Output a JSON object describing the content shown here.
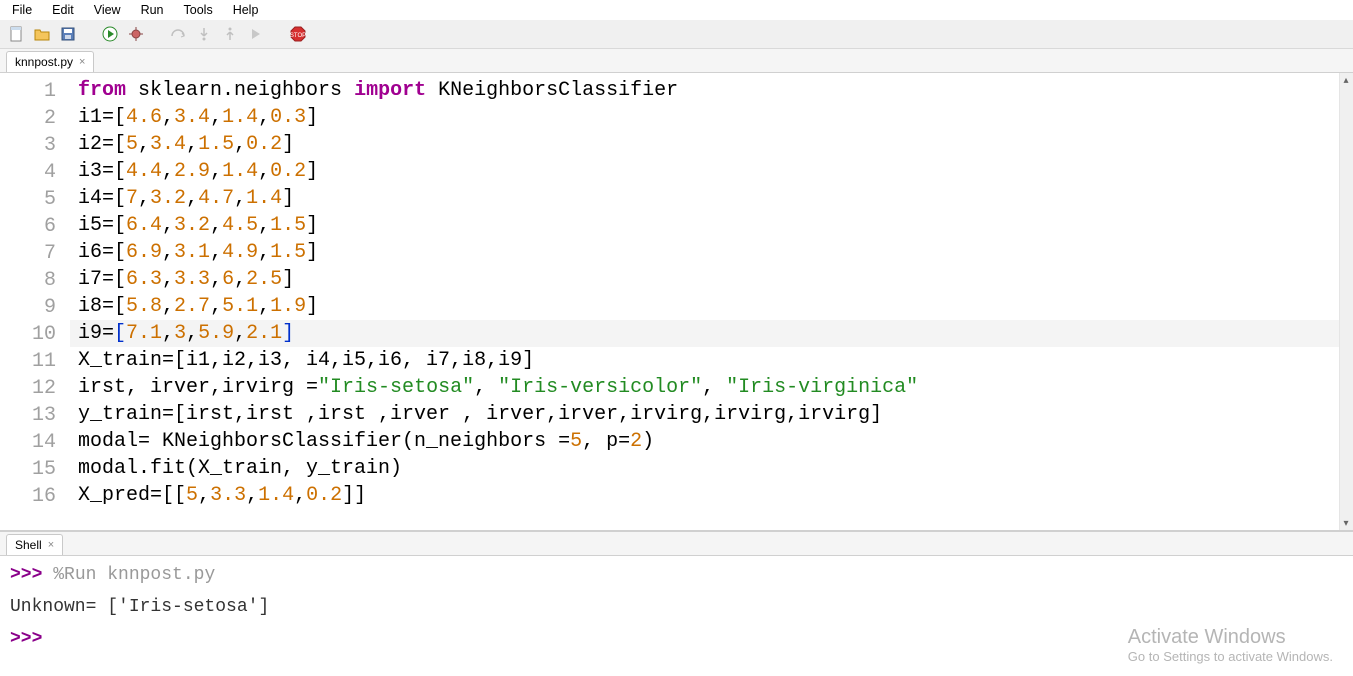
{
  "menubar": [
    "File",
    "Edit",
    "View",
    "Run",
    "Tools",
    "Help"
  ],
  "toolbar": {
    "new": "new-file-icon",
    "open": "open-folder-icon",
    "save": "save-icon",
    "run": "run-icon",
    "debug": "debug-icon",
    "step_over": "step-over-icon",
    "step_into": "step-into-icon",
    "step_out": "step-out-icon",
    "resume": "resume-icon",
    "stop": "stop-icon"
  },
  "editor_tab": {
    "label": "knnpost.py",
    "close": "×"
  },
  "code_lines": [
    {
      "n": 1,
      "tokens": [
        {
          "t": "from",
          "c": "kw"
        },
        {
          "t": " sklearn.neighbors ",
          "c": "pn"
        },
        {
          "t": "import",
          "c": "kw"
        },
        {
          "t": " KNeighborsClassifier",
          "c": "pn"
        }
      ]
    },
    {
      "n": 2,
      "tokens": [
        {
          "t": "i1=[",
          "c": "pn"
        },
        {
          "t": "4.6",
          "c": "nm"
        },
        {
          "t": ",",
          "c": "pn"
        },
        {
          "t": "3.4",
          "c": "nm"
        },
        {
          "t": ",",
          "c": "pn"
        },
        {
          "t": "1.4",
          "c": "nm"
        },
        {
          "t": ",",
          "c": "pn"
        },
        {
          "t": "0.3",
          "c": "nm"
        },
        {
          "t": "]",
          "c": "pn"
        }
      ]
    },
    {
      "n": 3,
      "tokens": [
        {
          "t": "i2=[",
          "c": "pn"
        },
        {
          "t": "5",
          "c": "nm"
        },
        {
          "t": ",",
          "c": "pn"
        },
        {
          "t": "3.4",
          "c": "nm"
        },
        {
          "t": ",",
          "c": "pn"
        },
        {
          "t": "1.5",
          "c": "nm"
        },
        {
          "t": ",",
          "c": "pn"
        },
        {
          "t": "0.2",
          "c": "nm"
        },
        {
          "t": "]",
          "c": "pn"
        }
      ]
    },
    {
      "n": 4,
      "tokens": [
        {
          "t": "i3=[",
          "c": "pn"
        },
        {
          "t": "4.4",
          "c": "nm"
        },
        {
          "t": ",",
          "c": "pn"
        },
        {
          "t": "2.9",
          "c": "nm"
        },
        {
          "t": ",",
          "c": "pn"
        },
        {
          "t": "1.4",
          "c": "nm"
        },
        {
          "t": ",",
          "c": "pn"
        },
        {
          "t": "0.2",
          "c": "nm"
        },
        {
          "t": "]",
          "c": "pn"
        }
      ]
    },
    {
      "n": 5,
      "tokens": [
        {
          "t": "i4=[",
          "c": "pn"
        },
        {
          "t": "7",
          "c": "nm"
        },
        {
          "t": ",",
          "c": "pn"
        },
        {
          "t": "3.2",
          "c": "nm"
        },
        {
          "t": ",",
          "c": "pn"
        },
        {
          "t": "4.7",
          "c": "nm"
        },
        {
          "t": ",",
          "c": "pn"
        },
        {
          "t": "1.4",
          "c": "nm"
        },
        {
          "t": "]",
          "c": "pn"
        }
      ]
    },
    {
      "n": 6,
      "tokens": [
        {
          "t": "i5=[",
          "c": "pn"
        },
        {
          "t": "6.4",
          "c": "nm"
        },
        {
          "t": ",",
          "c": "pn"
        },
        {
          "t": "3.2",
          "c": "nm"
        },
        {
          "t": ",",
          "c": "pn"
        },
        {
          "t": "4.5",
          "c": "nm"
        },
        {
          "t": ",",
          "c": "pn"
        },
        {
          "t": "1.5",
          "c": "nm"
        },
        {
          "t": "]",
          "c": "pn"
        }
      ]
    },
    {
      "n": 7,
      "tokens": [
        {
          "t": "i6=[",
          "c": "pn"
        },
        {
          "t": "6.9",
          "c": "nm"
        },
        {
          "t": ",",
          "c": "pn"
        },
        {
          "t": "3.1",
          "c": "nm"
        },
        {
          "t": ",",
          "c": "pn"
        },
        {
          "t": "4.9",
          "c": "nm"
        },
        {
          "t": ",",
          "c": "pn"
        },
        {
          "t": "1.5",
          "c": "nm"
        },
        {
          "t": "]",
          "c": "pn"
        }
      ]
    },
    {
      "n": 8,
      "tokens": [
        {
          "t": "i7=[",
          "c": "pn"
        },
        {
          "t": "6.3",
          "c": "nm"
        },
        {
          "t": ",",
          "c": "pn"
        },
        {
          "t": "3.3",
          "c": "nm"
        },
        {
          "t": ",",
          "c": "pn"
        },
        {
          "t": "6",
          "c": "nm"
        },
        {
          "t": ",",
          "c": "pn"
        },
        {
          "t": "2.5",
          "c": "nm"
        },
        {
          "t": "]",
          "c": "pn"
        }
      ]
    },
    {
      "n": 9,
      "tokens": [
        {
          "t": "i8=[",
          "c": "pn"
        },
        {
          "t": "5.8",
          "c": "nm"
        },
        {
          "t": ",",
          "c": "pn"
        },
        {
          "t": "2.7",
          "c": "nm"
        },
        {
          "t": ",",
          "c": "pn"
        },
        {
          "t": "5.1",
          "c": "nm"
        },
        {
          "t": ",",
          "c": "pn"
        },
        {
          "t": "1.9",
          "c": "nm"
        },
        {
          "t": "]",
          "c": "pn"
        }
      ]
    },
    {
      "n": 10,
      "hl": true,
      "tokens": [
        {
          "t": "i9=",
          "c": "pn"
        },
        {
          "t": "[",
          "c": "bl"
        },
        {
          "t": "7.1",
          "c": "nm"
        },
        {
          "t": ",",
          "c": "pn"
        },
        {
          "t": "3",
          "c": "nm"
        },
        {
          "t": ",",
          "c": "pn"
        },
        {
          "t": "5.9",
          "c": "nm"
        },
        {
          "t": ",",
          "c": "pn"
        },
        {
          "t": "2.1",
          "c": "nm"
        },
        {
          "t": "]",
          "c": "bl"
        }
      ]
    },
    {
      "n": 11,
      "tokens": [
        {
          "t": "X_train=[i1,i2,i3, i4,i5,i6, i7,i8,i9]",
          "c": "pn"
        }
      ]
    },
    {
      "n": 12,
      "tokens": [
        {
          "t": "irst, irver,irvirg =",
          "c": "pn"
        },
        {
          "t": "\"Iris-setosa\"",
          "c": "st"
        },
        {
          "t": ", ",
          "c": "pn"
        },
        {
          "t": "\"Iris-versicolor\"",
          "c": "st"
        },
        {
          "t": ", ",
          "c": "pn"
        },
        {
          "t": "\"Iris-virginica\"",
          "c": "st"
        }
      ]
    },
    {
      "n": 13,
      "tokens": [
        {
          "t": "y_train=[irst,irst ,irst ,irver , irver,irver,irvirg,irvirg,irvirg]",
          "c": "pn"
        }
      ]
    },
    {
      "n": 14,
      "tokens": [
        {
          "t": "modal= KNeighborsClassifier(n_neighbors =",
          "c": "pn"
        },
        {
          "t": "5",
          "c": "nm"
        },
        {
          "t": ", p=",
          "c": "pn"
        },
        {
          "t": "2",
          "c": "nm"
        },
        {
          "t": ")",
          "c": "pn"
        }
      ]
    },
    {
      "n": 15,
      "tokens": [
        {
          "t": "modal.fit(X_train, y_train)",
          "c": "pn"
        }
      ]
    },
    {
      "n": 16,
      "tokens": [
        {
          "t": "X_pred=[[",
          "c": "pn"
        },
        {
          "t": "5",
          "c": "nm"
        },
        {
          "t": ",",
          "c": "pn"
        },
        {
          "t": "3.3",
          "c": "nm"
        },
        {
          "t": ",",
          "c": "pn"
        },
        {
          "t": "1.4",
          "c": "nm"
        },
        {
          "t": ",",
          "c": "pn"
        },
        {
          "t": "0.2",
          "c": "nm"
        },
        {
          "t": "]]",
          "c": "pn"
        }
      ]
    }
  ],
  "shell_tab": {
    "label": "Shell",
    "close": "×"
  },
  "shell": {
    "prompt": ">>>",
    "run_cmd": "%Run  knnpost.py",
    "output": " Unknown= ['Iris-setosa']"
  },
  "watermark": {
    "title": "Activate Windows",
    "sub": "Go to Settings to activate Windows."
  }
}
